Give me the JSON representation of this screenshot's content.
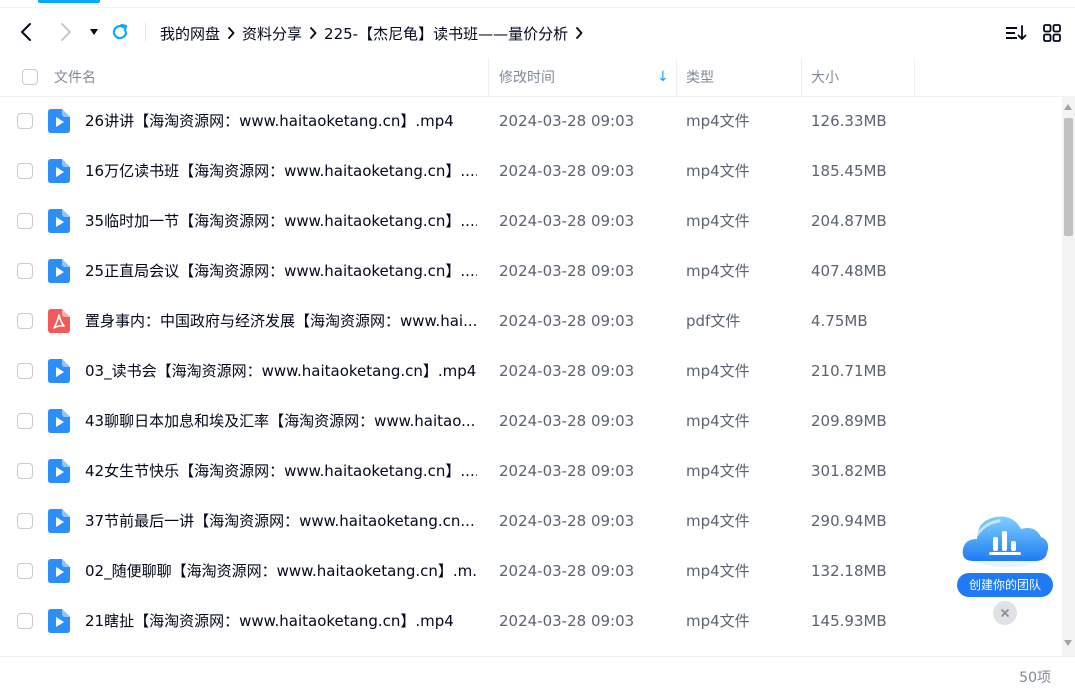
{
  "nav": {
    "back_icon": "chevron-left-icon",
    "forward_icon": "chevron-right-icon",
    "dropdown_icon": "caret-down-icon",
    "refresh_icon": "refresh-icon",
    "breadcrumb": [
      "我的网盘",
      "资料分享",
      "225-【杰尼龟】读书班——量价分析"
    ],
    "sort_icon": "sort-list-icon",
    "grid_icon": "grid-view-icon"
  },
  "table": {
    "columns": {
      "name": "文件名",
      "time": "修改时间",
      "type": "类型",
      "size": "大小"
    },
    "sort_indicator": "↓",
    "rows": [
      {
        "name": "26讲讲【海淘资源网：www.haitaoketang.cn】.mp4",
        "time": "2024-03-28 09:03",
        "type": "mp4文件",
        "size": "126.33MB",
        "icon": "video-file-icon"
      },
      {
        "name": "16万亿读书班【海淘资源网：www.haitaoketang.cn】....",
        "time": "2024-03-28 09:03",
        "type": "mp4文件",
        "size": "185.45MB",
        "icon": "video-file-icon"
      },
      {
        "name": "35临时加一节【海淘资源网：www.haitaoketang.cn】....",
        "time": "2024-03-28 09:03",
        "type": "mp4文件",
        "size": "204.87MB",
        "icon": "video-file-icon"
      },
      {
        "name": "25正直局会议【海淘资源网：www.haitaoketang.cn】....",
        "time": "2024-03-28 09:03",
        "type": "mp4文件",
        "size": "407.48MB",
        "icon": "video-file-icon"
      },
      {
        "name": "置身事内：中国政府与经济发展【海淘资源网：www.hai...",
        "time": "2024-03-28 09:03",
        "type": "pdf文件",
        "size": "4.75MB",
        "icon": "pdf-file-icon"
      },
      {
        "name": "03_读书会【海淘资源网：www.haitaoketang.cn】.mp4",
        "time": "2024-03-28 09:03",
        "type": "mp4文件",
        "size": "210.71MB",
        "icon": "video-file-icon"
      },
      {
        "name": "43聊聊日本加息和埃及汇率【海淘资源网：www.haitao...",
        "time": "2024-03-28 09:03",
        "type": "mp4文件",
        "size": "209.89MB",
        "icon": "video-file-icon"
      },
      {
        "name": "42女生节快乐【海淘资源网：www.haitaoketang.cn】....",
        "time": "2024-03-28 09:03",
        "type": "mp4文件",
        "size": "301.82MB",
        "icon": "video-file-icon"
      },
      {
        "name": "37节前最后一讲【海淘资源网：www.haitaoketang.cn...",
        "time": "2024-03-28 09:03",
        "type": "mp4文件",
        "size": "290.94MB",
        "icon": "video-file-icon"
      },
      {
        "name": "02_随便聊聊【海淘资源网：www.haitaoketang.cn】.m...",
        "time": "2024-03-28 09:03",
        "type": "mp4文件",
        "size": "132.18MB",
        "icon": "video-file-icon"
      },
      {
        "name": "21瞎扯【海淘资源网：www.haitaoketang.cn】.mp4",
        "time": "2024-03-28 09:03",
        "type": "mp4文件",
        "size": "145.93MB",
        "icon": "video-file-icon"
      }
    ]
  },
  "footer": {
    "count": "50项"
  },
  "team_widget": {
    "label": "创建你的团队",
    "icon": "team-cloud-icon",
    "close_icon": "close-icon"
  },
  "colors": {
    "accent": "#06a7ff",
    "video_icon": "#2c8ef8",
    "pdf_icon": "#f25a5a",
    "widget_blue": "#1e7bf5"
  }
}
